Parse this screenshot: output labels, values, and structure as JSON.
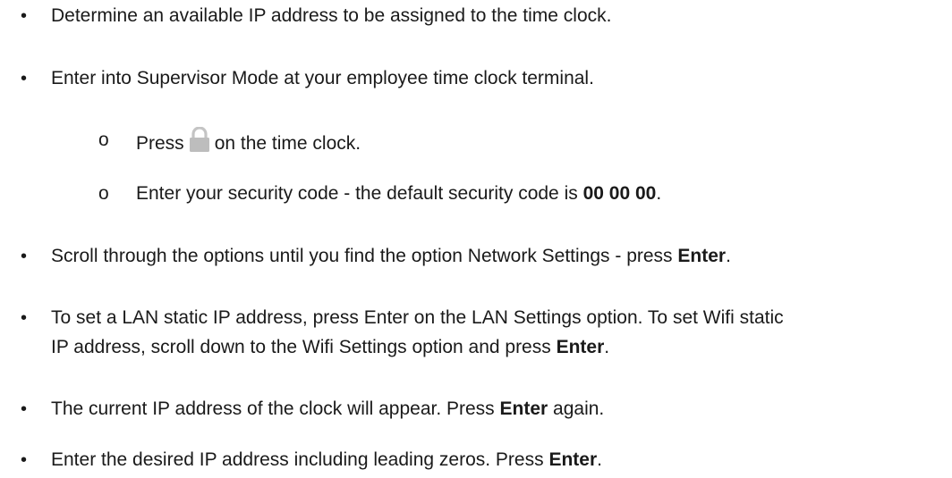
{
  "steps": [
    {
      "bullet": "•",
      "text": "Determine an available IP address to be assigned to the time clock."
    },
    {
      "bullet": "•",
      "text": "Enter into Supervisor Mode at your employee time clock terminal."
    },
    {
      "bullet": "•",
      "before": "Scroll through the options until you find the option Network Settings - press ",
      "bold": "Enter",
      "after": "."
    },
    {
      "bullet": "•",
      "line1": "To set a LAN static IP address, press Enter on the LAN Settings option. To set Wifi static",
      "line2_before": "IP address, scroll down to the Wifi Settings option and press ",
      "bold": "Enter",
      "after": "."
    },
    {
      "bullet": "•",
      "before": "The current IP address of the clock will appear. Press ",
      "bold": "Enter",
      "after": " again."
    },
    {
      "bullet": "•",
      "before": "Enter the desired IP address including leading zeros. Press ",
      "bold": "Enter",
      "after": "."
    }
  ],
  "substeps": [
    {
      "marker": "o",
      "before": "Press",
      "icon": "lock-icon",
      "after": "on the time clock."
    },
    {
      "marker": "o",
      "before": "Enter your security code - the default security code is ",
      "bold": "00 00 00",
      "after": "."
    }
  ],
  "colors": {
    "text": "#1a1a1a",
    "lock_icon": "#bdbdbd"
  }
}
